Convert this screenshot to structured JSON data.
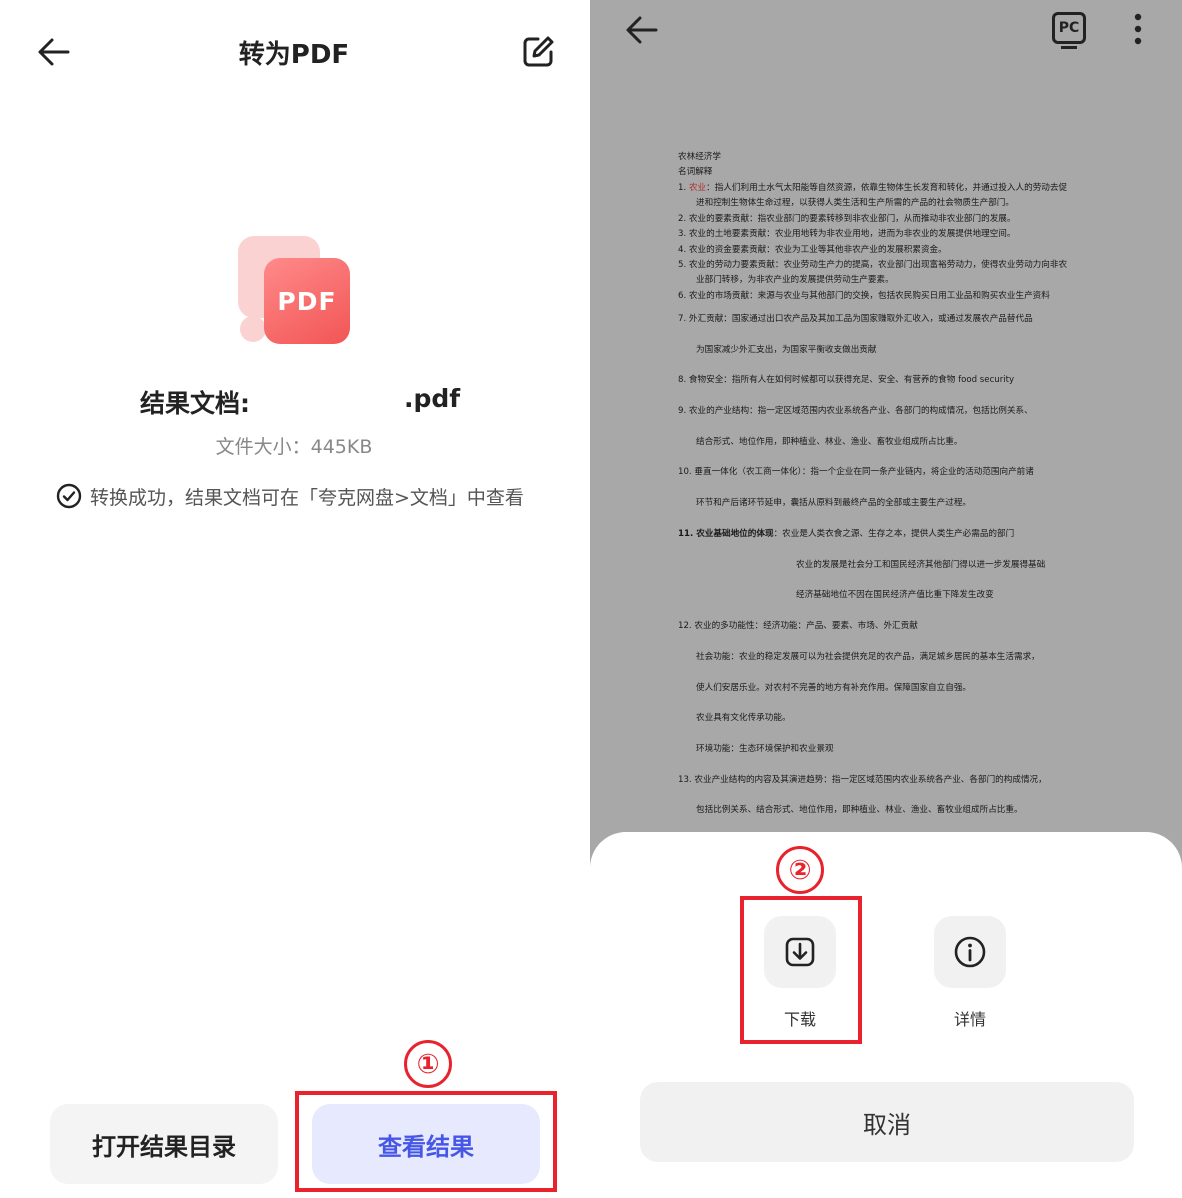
{
  "left": {
    "title": "转为PDF",
    "logo_text": "PDF",
    "result_label": "结果文档:",
    "result_filename": ".pdf",
    "file_size": "文件大小：445KB",
    "success_message": "转换成功，结果文档可在「夸克网盘>文档」中查看",
    "open_folder_button": "打开结果目录",
    "view_result_button": "查看结果",
    "step_marker": "①"
  },
  "right": {
    "pc_badge": "PC",
    "document": {
      "lines": [
        "农林经济学",
        "名词解释",
        "1.   农业：指人们利用土水气太阳能等自然资源，依靠生物体生长发育和转化，并通过投入人的劳动去促",
        "进和控制生物体生命过程，以获得人类生活和生产所需的产品的社会物质生产部门。",
        "2.   农业的要素贡献：指农业部门的要素转移到非农业部门，从而推动非农业部门的发展。",
        "3.   农业的土地要素贡献：农业用地转为非农业用地，进而为非农业的发展提供地理空间。",
        "4.   农业的资金要素贡献：农业为工业等其他非农产业的发展积累资金。",
        "5.   农业的劳动力要素贡献：农业劳动生产力的提高，农业部门出现富裕劳动力，使得农业劳动力向非农",
        "业部门转移，为非农产业的发展提供劳动生产要素。",
        "6.   农业的市场贡献：来源与农业与其他部门的交换，包括农民购买日用工业品和购买农业生产资料",
        "7.   外汇贡献：国家通过出口农产品及其加工品为国家赚取外汇收入，或通过发展农产品替代品",
        "为国家减少外汇支出，为国家平衡收支做出贡献",
        "8.    食物安全：指所有人在如何时候都可以获得充足、安全、有营养的食物 food security",
        "9.   农业的产业结构：指一定区域范围内农业系统各产业、各部门的构成情况，包括比例关系、",
        "结合形式、地位作用，即种植业、林业、渔业、畜牧业组成所占比重。",
        "10. 垂直一体化（农工商一体化）：指一个企业在同一条产业链内，将企业的活动范围向产前诸",
        "环节和产后诸环节延申，囊括从原料到最终产品的全部或主要生产过程。",
        "11. 农业基础地位的体现：农业是人类衣食之源、生存之本，提供人类生产必需品的部门",
        "农业的发展是社会分工和国民经济其他部门得以进一步发展得基础",
        "经济基础地位不因在国民经济产值比重下降发生改变",
        "12. 农业的多功能性：经济功能：产品、要素、市场、外汇贡献",
        "社会功能：农业的稳定发展可以为社会提供充足的农产品，满足城乡居民的基本生活需求，",
        "使人们安居乐业。对农村不完善的地方有补充作用。保障国家自立自强。",
        "农业具有文化传承功能。",
        "环境功能：生态环境保护和农业景观",
        "13. 农业产业结构的内容及其演进趋势：指一定区域范围内农业系统各产业、各部门的构成情况，",
        "包括比例关系、结合形式、地位作用，即种植业、林业、渔业、畜牧业组成所占比重。"
      ]
    },
    "download_label": "下载",
    "details_label": "详情",
    "cancel_button": "取消",
    "step_marker": "②"
  },
  "icons": {
    "back": "arrow-left-icon",
    "edit": "edit-square-icon",
    "more": "more-vertical-icon",
    "download": "download-icon",
    "info": "info-icon",
    "check": "check-circle-icon"
  },
  "colors": {
    "highlight": "#e8232d",
    "primary_button_text": "#4656e6",
    "primary_button_bg": "#e7eaff",
    "pdf_red": "#f25555"
  }
}
